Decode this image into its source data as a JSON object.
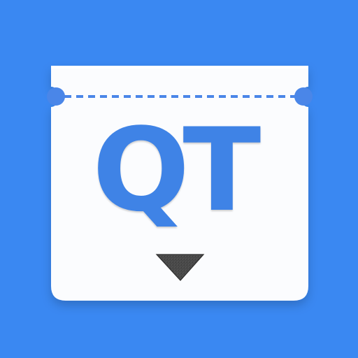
{
  "icon": {
    "monogram": "QT",
    "colors": {
      "background": "#3a88f2",
      "ticket": "#fbfcfe",
      "notch_and_perforation": "#4a86e8",
      "monogram": "#3f83e6",
      "down_arrow": "#4a4a4a"
    },
    "icons": [
      "ticket-icon",
      "perforation-line-icon",
      "down-arrow-icon"
    ]
  }
}
